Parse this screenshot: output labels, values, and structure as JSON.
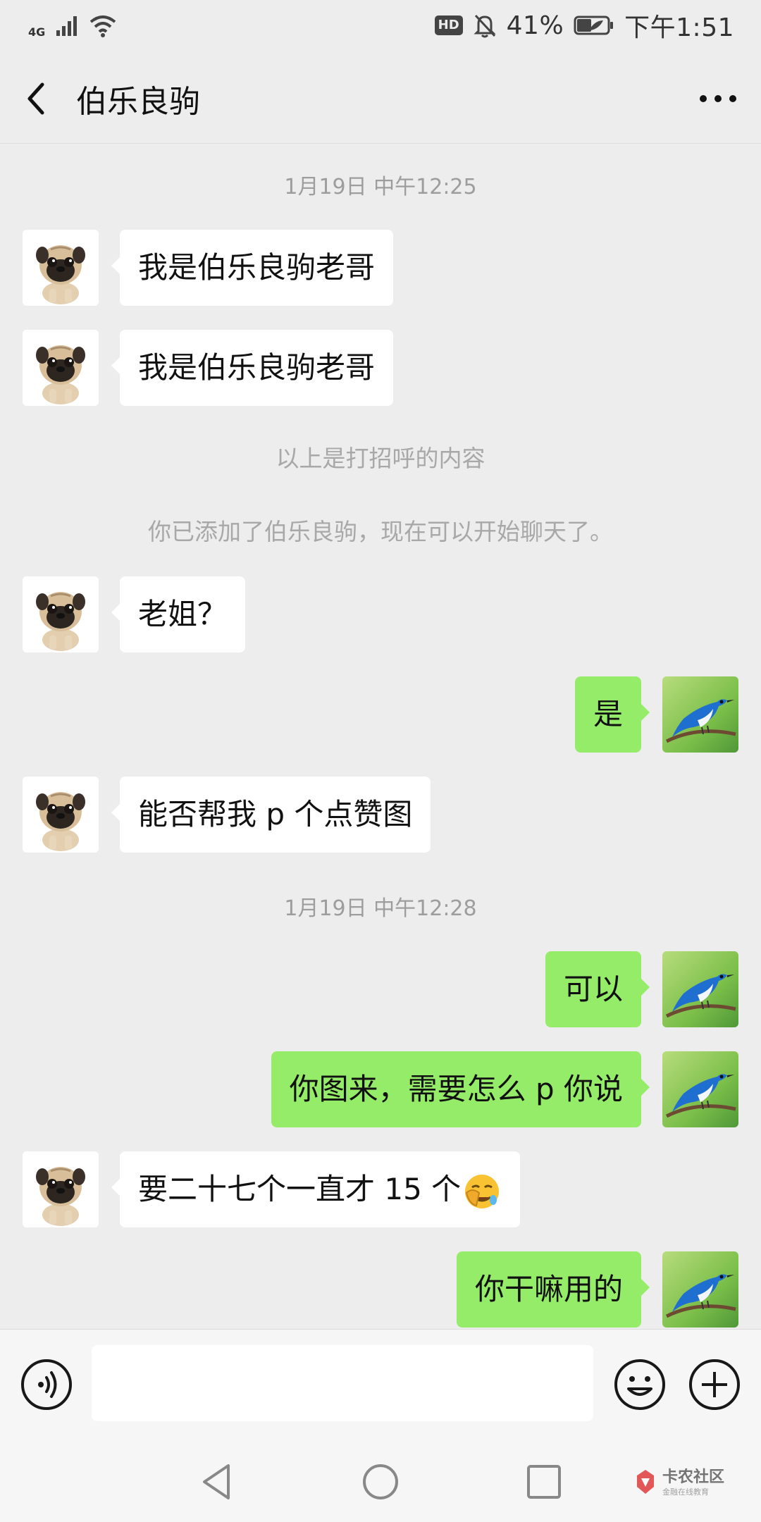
{
  "status_bar": {
    "network": "4G",
    "hd": "HD",
    "battery": "41%",
    "time": "下午1:51"
  },
  "header": {
    "title": "伯乐良驹"
  },
  "messages": {
    "ts1": "1月19日 中午12:25",
    "m1": "我是伯乐良驹老哥",
    "m2": "我是伯乐良驹老哥",
    "note1": "以上是打招呼的内容",
    "note2": "你已添加了伯乐良驹，现在可以开始聊天了。",
    "m3": "老姐？",
    "m4": "是",
    "m5": "能否帮我 p 个点赞图",
    "ts2": "1月19日 中午12:28",
    "m6": "可以",
    "m7": "你图来，需要怎么 p 你说",
    "m8": "要二十七个一直才 15 个",
    "m9": "你干嘛用的"
  },
  "input_bar": {
    "value": ""
  },
  "watermark": {
    "name": "卡农社区",
    "tagline": "金融在线教育"
  },
  "colors": {
    "bubble_out": "#95ec69",
    "bubble_in": "#ffffff",
    "background": "#ededed"
  }
}
